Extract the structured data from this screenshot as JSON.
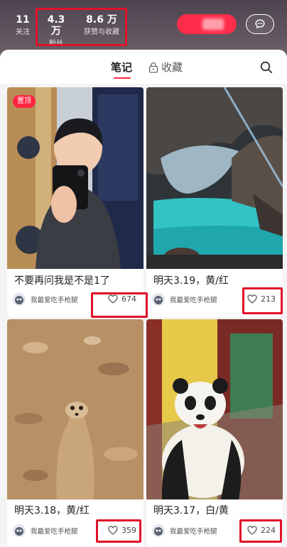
{
  "stats": {
    "following": {
      "value": "11",
      "label": "关注"
    },
    "fans": {
      "value": "4.3 万",
      "label": "粉丝"
    },
    "likes_and_collects": {
      "value": "8.6 万",
      "label": "获赞与收藏"
    }
  },
  "tabs": {
    "notes": "笔记",
    "collections": "收藏"
  },
  "notes": [
    {
      "title": "不要再问我是不是1了",
      "author": "我最爱吃手枪腿",
      "likes": "674",
      "pinned_label": "置顶"
    },
    {
      "title": "明天3.19，黄/红",
      "author": "我最爱吃手枪腿",
      "likes": "213"
    },
    {
      "title": "明天3.18，黄/红",
      "author": "我最爱吃手枪腿",
      "likes": "359"
    },
    {
      "title": "明天3.17，白/黄",
      "author": "我最爱吃手枪腿",
      "likes": "224"
    }
  ],
  "colors": {
    "accent": "#ff2442",
    "highlight_box": "#e2102a",
    "header_bg": "#5a4f58"
  },
  "icons": [
    "chat-bubble-icon",
    "lock-icon",
    "search-icon",
    "heart-icon"
  ]
}
